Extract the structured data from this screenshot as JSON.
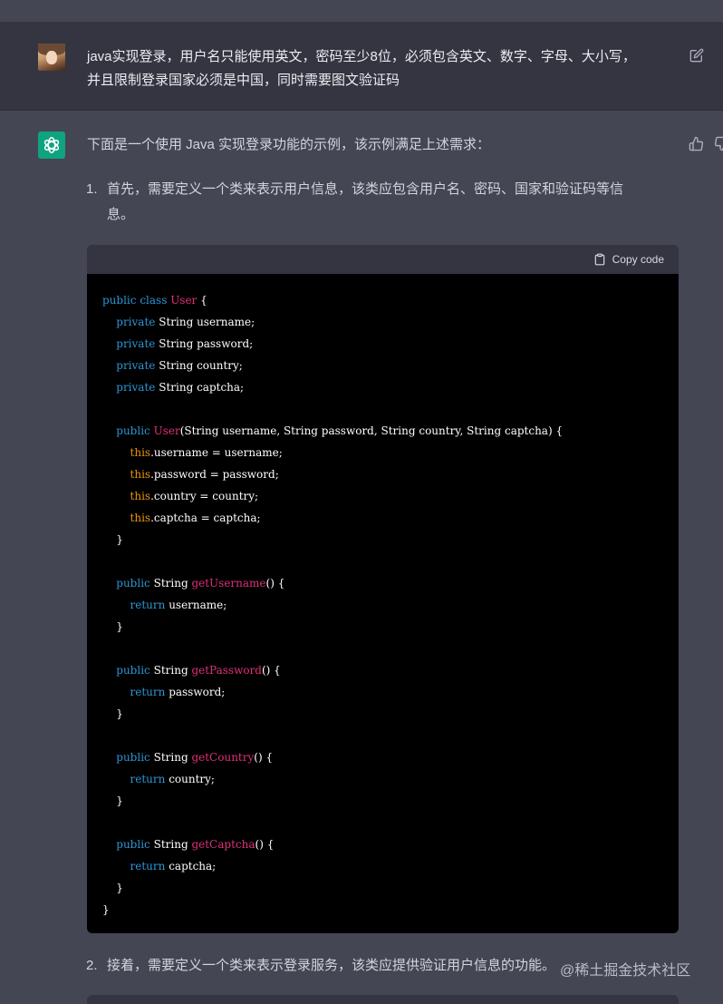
{
  "user": {
    "line1": "java实现登录，用户名只能使用英文，密码至少8位，必须包含英文、数字、字母、大小写，",
    "line2": "并且限制登录国家必须是中国，同时需要图文验证码"
  },
  "assistant": {
    "intro": "下面是一个使用 Java 实现登录功能的示例，该示例满足上述需求：",
    "step1": {
      "num": "1.",
      "line1": "首先，需要定义一个类来表示用户信息，该类应包含用户名、密码、国家和验证码等信",
      "line2": "息。"
    },
    "copy_label": "Copy code",
    "step2": {
      "num": "2.",
      "text": "接着，需要定义一个类来表示登录服务，该类应提供验证用户信息的功能。"
    }
  },
  "code": {
    "public": "public",
    "class": "class",
    "private": "private",
    "this": "this",
    "return": "return",
    "String": "String",
    "User": "User",
    "getUsername": "getUsername",
    "getPassword": "getPassword",
    "getCountry": "getCountry",
    "getCaptcha": "getCaptcha"
  },
  "watermark": "@稀土掘金技术社区",
  "colors": {
    "bg": "#444654",
    "user_bg": "#343541",
    "accent": "#10a37f",
    "code_bg": "#000000"
  },
  "icons": [
    "edit-icon",
    "chatgpt-logo-icon",
    "thumb-up-icon",
    "thumb-down-icon",
    "clipboard-icon"
  ]
}
